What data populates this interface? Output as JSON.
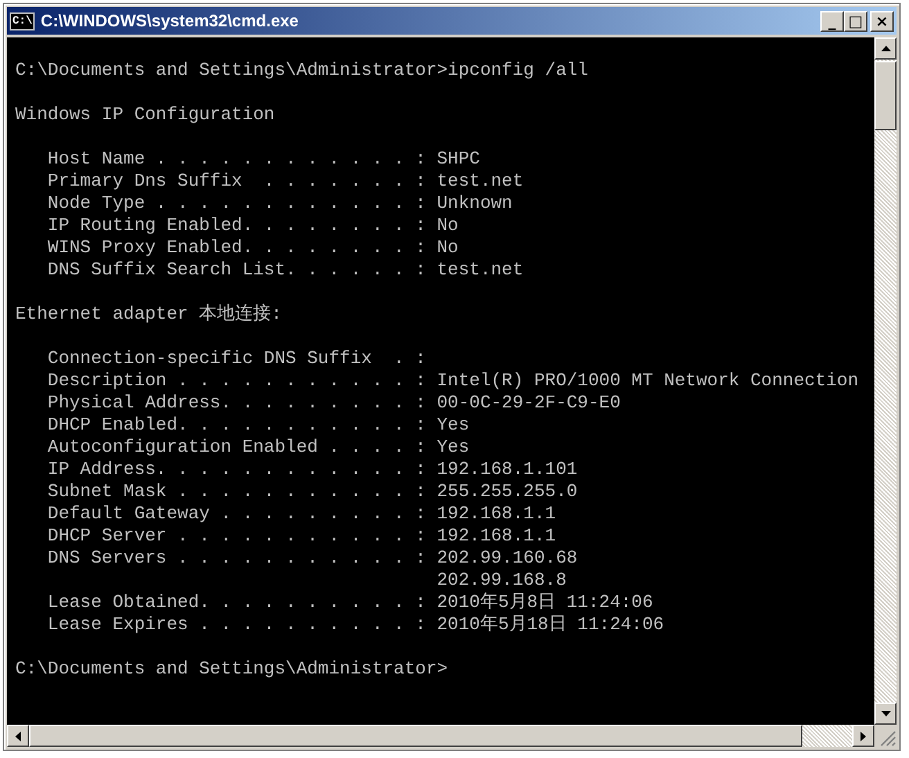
{
  "window": {
    "title": "C:\\WINDOWS\\system32\\cmd.exe",
    "icon_text": "C:\\",
    "buttons": [
      {
        "kind": "minimize",
        "label": "_"
      },
      {
        "kind": "maximize",
        "label": "□"
      },
      {
        "kind": "close",
        "label": "×"
      }
    ]
  },
  "console": {
    "blocks": [
      [
        "C:\\Documents and Settings\\Administrator>ipconfig /all"
      ],
      [
        "Windows IP Configuration"
      ],
      [
        "   Host Name . . . . . . . . . . . . : SHPC",
        "   Primary Dns Suffix  . . . . . . . : test.net",
        "   Node Type . . . . . . . . . . . . : Unknown",
        "   IP Routing Enabled. . . . . . . . : No",
        "   WINS Proxy Enabled. . . . . . . . : No",
        "   DNS Suffix Search List. . . . . . : test.net"
      ],
      [
        "Ethernet adapter 本地连接:"
      ],
      [
        "   Connection-specific DNS Suffix  . :",
        "   Description . . . . . . . . . . . : Intel(R) PRO/1000 MT Network Connection",
        "   Physical Address. . . . . . . . . : 00-0C-29-2F-C9-E0",
        "   DHCP Enabled. . . . . . . . . . . : Yes",
        "   Autoconfiguration Enabled . . . . : Yes",
        "   IP Address. . . . . . . . . . . . : 192.168.1.101",
        "   Subnet Mask . . . . . . . . . . . : 255.255.255.0",
        "   Default Gateway . . . . . . . . . : 192.168.1.1",
        "   DHCP Server . . . . . . . . . . . : 192.168.1.1",
        "   DNS Servers . . . . . . . . . . . : 202.99.160.68",
        "                                       202.99.168.8",
        "   Lease Obtained. . . . . . . . . . : 2010年5月8日 11:24:06",
        "   Lease Expires . . . . . . . . . . : 2010年5月18日 11:24:06"
      ],
      [
        "C:\\Documents and Settings\\Administrator>"
      ]
    ]
  }
}
